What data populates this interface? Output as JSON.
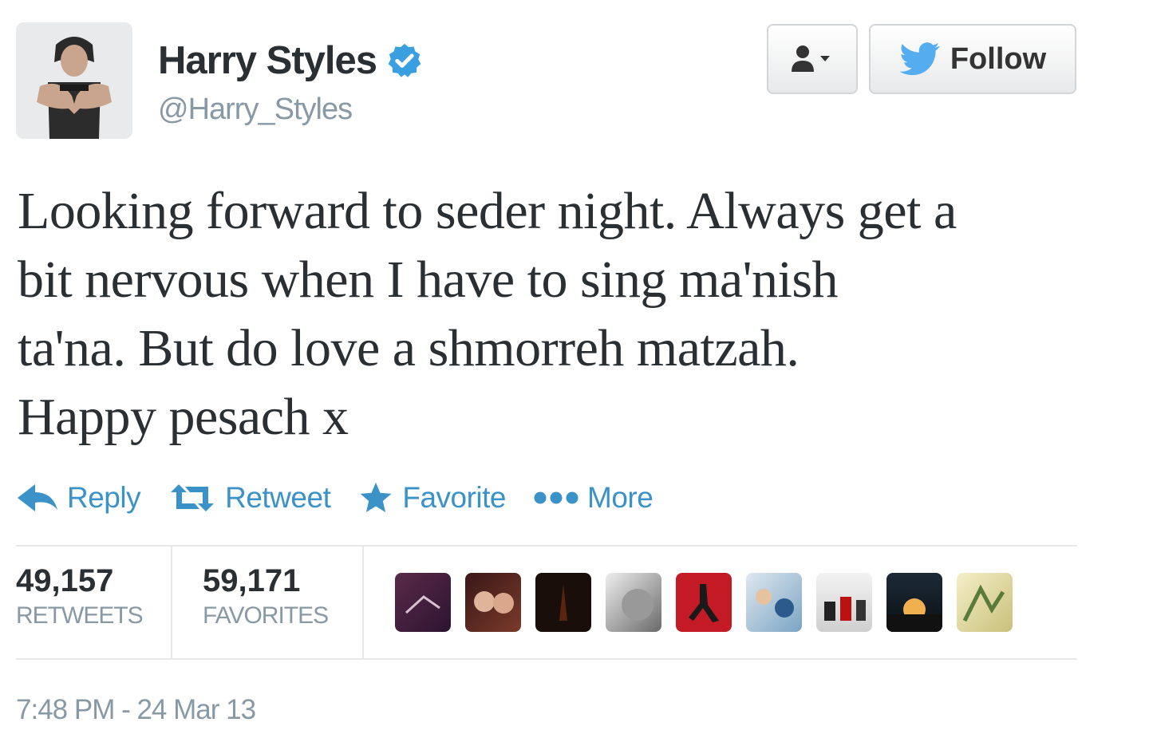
{
  "user": {
    "name": "Harry Styles",
    "handle": "@Harry_Styles"
  },
  "buttons": {
    "follow_label": "Follow"
  },
  "tweet": {
    "lines": [
      "Looking forward to seder night. Always get a",
      "bit nervous when I have to sing ma'nish",
      "ta'na. But do love a shmorreh matzah.",
      "Happy pesach x"
    ]
  },
  "actions": [
    {
      "label": "Reply",
      "icon": "reply-icon"
    },
    {
      "label": "Retweet",
      "icon": "retweet-icon"
    },
    {
      "label": "Favorite",
      "icon": "star-icon"
    },
    {
      "label": "More",
      "icon": "more-dots-icon"
    }
  ],
  "stats": {
    "retweets": {
      "count": "49,157",
      "label": "RETWEETS"
    },
    "favorites": {
      "count": "59,171",
      "label": "FAVORITES"
    }
  },
  "timestamp": "7:48 PM - 24 Mar 13",
  "colors": {
    "link": "#3a92c8",
    "verified": "#3a9fe0",
    "twitter_bird": "#55acee",
    "muted": "#8899a6"
  }
}
